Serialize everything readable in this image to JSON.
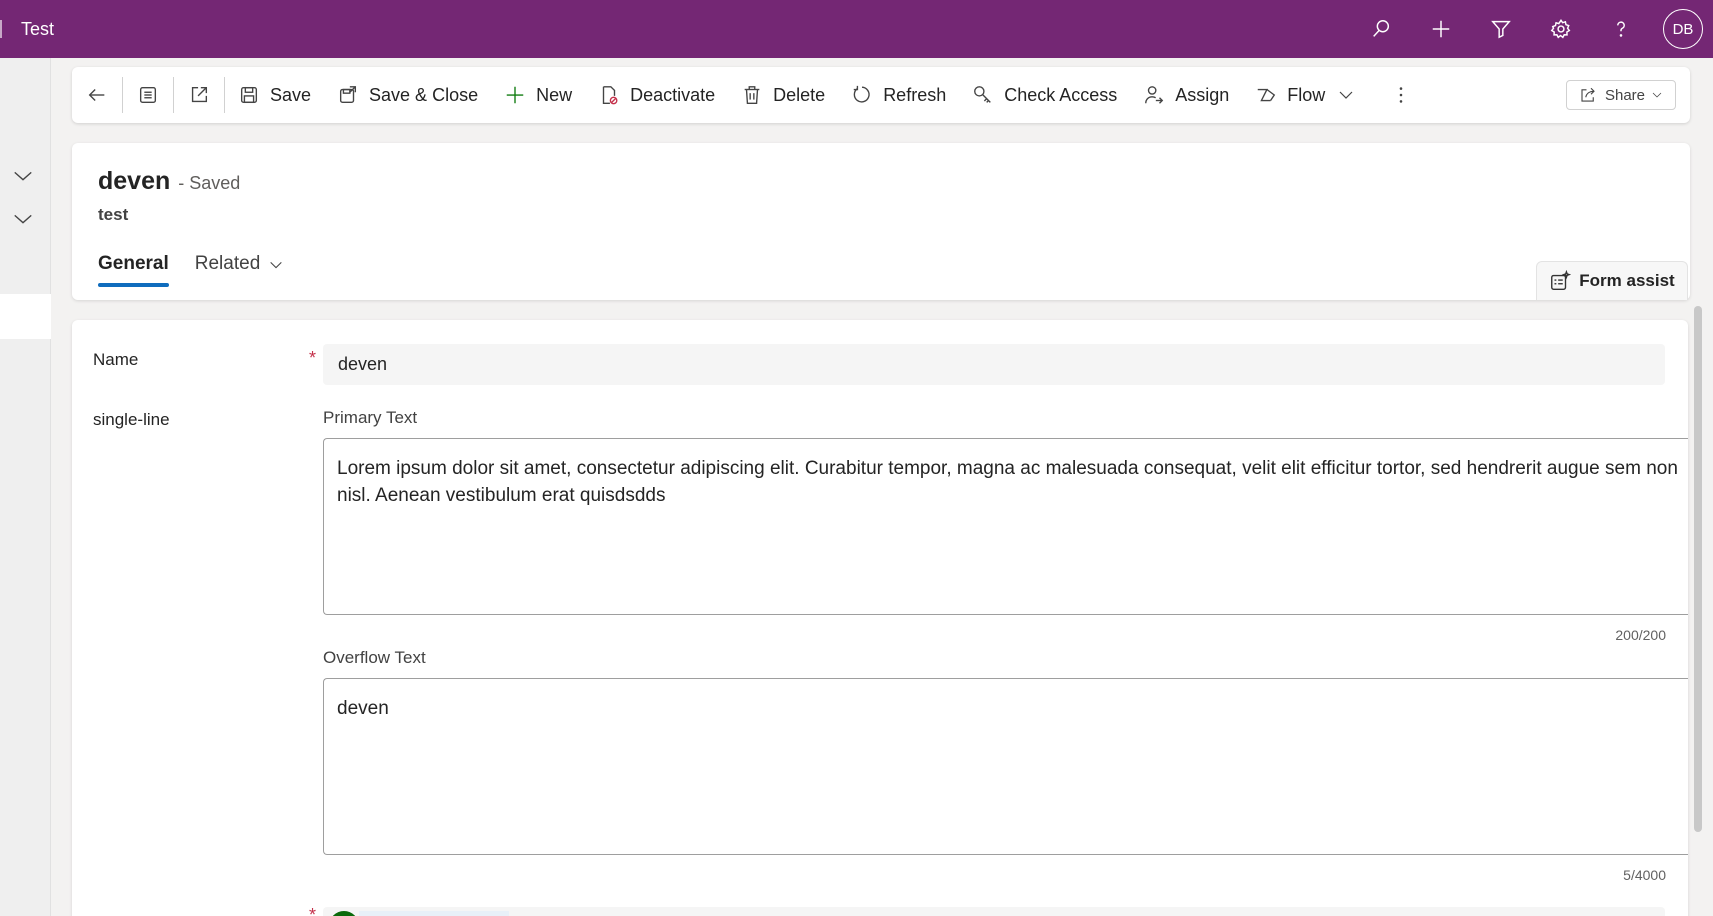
{
  "app": {
    "title": "Test"
  },
  "topbar": {
    "icons": [
      "search-icon",
      "plus-icon",
      "filter-icon",
      "settings-icon",
      "help-icon"
    ],
    "avatar_initials": "DB"
  },
  "toolbar": {
    "save": "Save",
    "save_close": "Save & Close",
    "new": "New",
    "deactivate": "Deactivate",
    "delete": "Delete",
    "refresh": "Refresh",
    "check_access": "Check Access",
    "assign": "Assign",
    "flow": "Flow",
    "share": "Share"
  },
  "record": {
    "name": "deven",
    "status": "- Saved",
    "entity": "test"
  },
  "tabs": [
    {
      "label": "General",
      "active": true
    },
    {
      "label": "Related",
      "active": false
    }
  ],
  "form_assist": {
    "label": "Form assist"
  },
  "form": {
    "name_label": "Name",
    "name_required": "*",
    "name_value": "deven",
    "section_label": "single-line",
    "primary_label": "Primary Text",
    "primary_value": "Lorem ipsum dolor sit amet, consectetur adipiscing elit. Curabitur tempor, magna ac malesuada consequat, velit elit efficitur tortor, sed hendrerit augue sem non nisl. Aenean vestibulum erat quisdsdds",
    "primary_counter": "200/200",
    "overflow_label": "Overflow Text",
    "overflow_value": "deven",
    "overflow_counter": "5/4000",
    "owner_required": "*"
  },
  "colors": {
    "topbar": "#742774",
    "accent": "#0f6cbd",
    "required": "#c4314b",
    "add_icon": "#107c10"
  }
}
